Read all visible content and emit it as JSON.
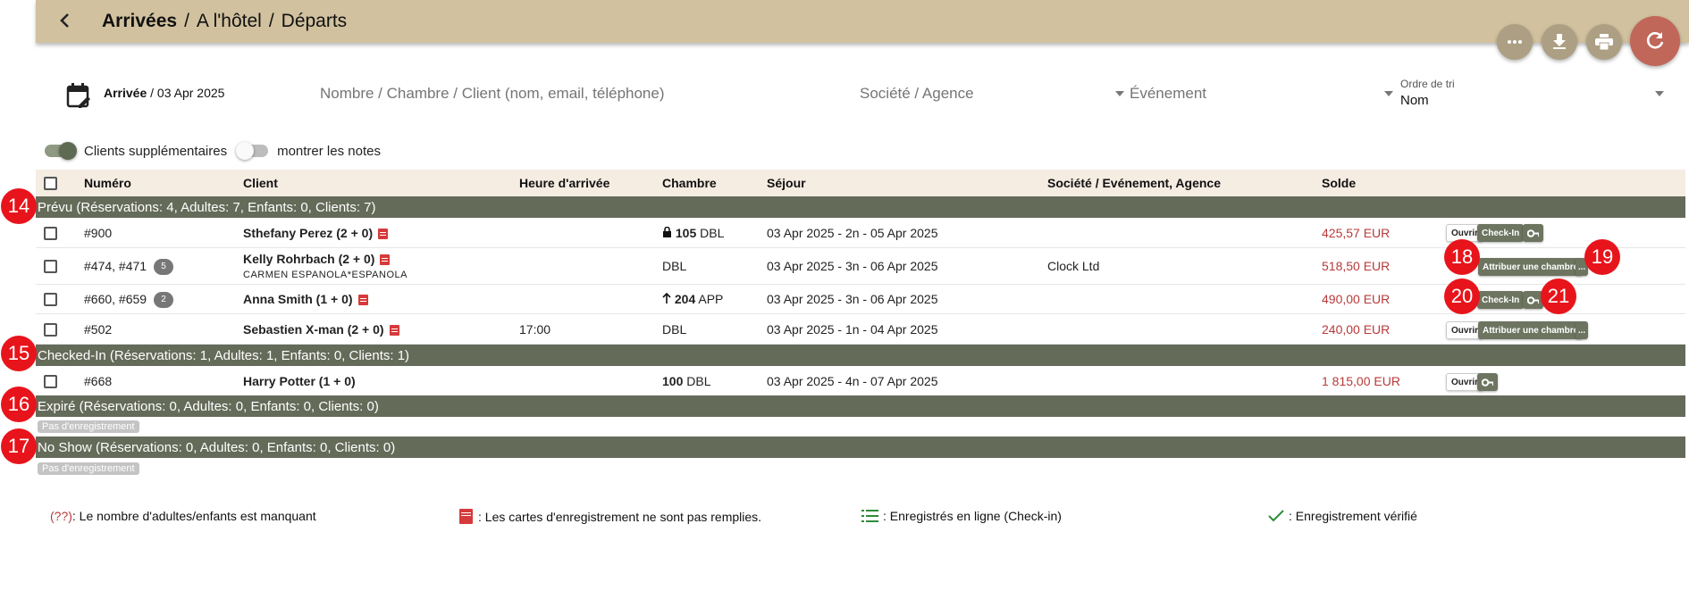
{
  "header": {
    "breadcrumb": [
      "Arrivées",
      "A l'hôtel",
      "Départs"
    ],
    "actions": [
      "more-icon",
      "download-icon",
      "print-icon",
      "refresh-icon"
    ],
    "bg_color": "#d1c19e"
  },
  "filters": {
    "arrival_label": "Arrivée",
    "arrival_date": " / 03 Apr 2025",
    "search_placeholder": "Nombre / Chambre / Client (nom, email, téléphone)",
    "company_placeholder": "Société / Agence",
    "event_placeholder": "Événement",
    "sort_caption": "Ordre de tri",
    "sort_value": "Nom"
  },
  "toggles": {
    "extra_clients": {
      "label": "Clients supplémentaires",
      "on": true
    },
    "show_notes": {
      "label": "montrer les notes",
      "on": false
    }
  },
  "table": {
    "headers": {
      "number": "Numéro",
      "client": "Client",
      "arrival_time": "Heure d'arrivée",
      "room": "Chambre",
      "stay": "Séjour",
      "company": "Société / Evénement, Agence",
      "balance": "Solde"
    },
    "groups": {
      "planned": "Prévu (Réservations: 4, Adultes: 7, Enfants: 0, Clients: 7)",
      "checked_in": "Checked-In (Réservations: 1, Adultes: 1, Enfants: 0, Clients: 1)",
      "expired": "Expiré (Réservations: 0, Adultes: 0, Enfants: 0, Clients: 0)",
      "no_show": "No Show (Réservations: 0, Adultes: 0, Enfants: 0, Clients: 0)"
    },
    "rows": [
      {
        "number": "#900",
        "client": "Sthefany Perez (2 + 0)",
        "sub": "",
        "count": "",
        "time": "",
        "room_num": "105",
        "room_type": " DBL",
        "stay": "03 Apr 2025 - 2n - 05 Apr 2025",
        "company": "",
        "balance": "425,57 EUR"
      },
      {
        "number": "#474, #471",
        "client": "Kelly Rohrbach (2 + 0)",
        "sub": "CARMEN ESPANOLA*ESPANOLA",
        "count": "5",
        "time": "",
        "room_num": "",
        "room_type": "DBL",
        "stay": "03 Apr 2025 - 3n - 06 Apr 2025",
        "company": "Clock Ltd",
        "balance": "518,50 EUR"
      },
      {
        "number": "#660, #659",
        "client": "Anna Smith (1 + 0)",
        "sub": "",
        "count": "2",
        "time": "",
        "room_num": "204",
        "room_type": " APP",
        "stay": "03 Apr 2025 - 3n - 06 Apr 2025",
        "company": "",
        "balance": "490,00 EUR"
      },
      {
        "number": "#502",
        "client": "Sebastien X-man (2 + 0)",
        "sub": "",
        "count": "",
        "time": "17:00",
        "room_num": "",
        "room_type": "DBL",
        "stay": "03 Apr 2025 - 1n - 04 Apr 2025",
        "company": "",
        "balance": "240,00 EUR"
      },
      {
        "number": "#668",
        "client": "Harry Potter (1 + 0)",
        "sub": "",
        "count": "",
        "time": "",
        "room_num": "100",
        "room_type": " DBL",
        "stay": "03 Apr 2025 - 4n - 07 Apr 2025",
        "company": "",
        "balance": "1 815,00 EUR"
      }
    ],
    "buttons": {
      "open": "Ouvrir",
      "checkin": "Check-In",
      "assign_room": "Attribuer une chambre",
      "more": "..."
    },
    "no_record": "Pas d'enregistrement"
  },
  "markers": [
    "14",
    "15",
    "16",
    "17",
    "18",
    "19",
    "20",
    "21"
  ],
  "legend": {
    "missing_prefix": "(??)",
    "missing": " : Le nombre d'adultes/enfants est manquant",
    "cards": ": Les cartes d'enregistrement ne sont pas remplies.",
    "online": ": Enregistrés en ligne (Check-in)",
    "verified": ": Enregistrement vérifié"
  },
  "colors": {
    "group_bg": "#656b59",
    "accent_red": "#b83a3a",
    "marker_red": "#e8141b",
    "fab_refresh": "#c0675a"
  }
}
